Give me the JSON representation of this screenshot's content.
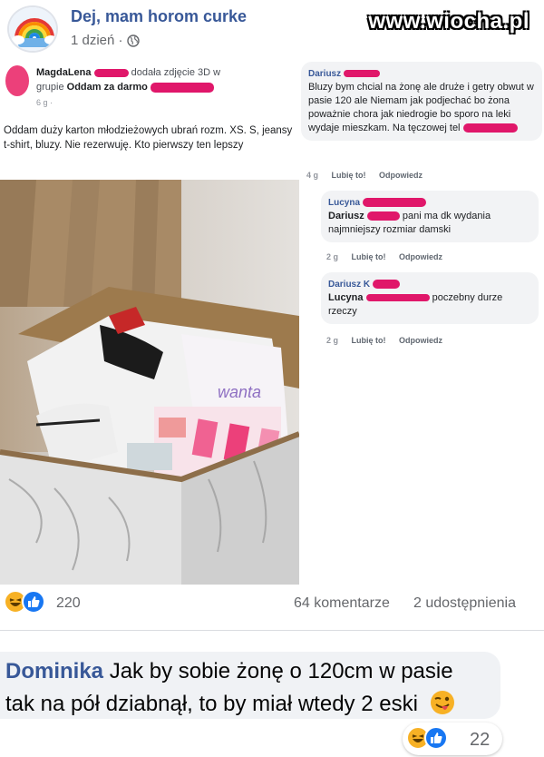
{
  "header": {
    "page_name": "Dej, mam horom curke",
    "time": "1 dzień ·",
    "watermark": "www.wiocha.pl"
  },
  "inner_post": {
    "author": "MagdaLena",
    "action": "dodała zdjęcie 3D w",
    "group_prefix": "grupie",
    "group_name": "Oddam za darmo",
    "time": "6 g ·",
    "body": "Oddam duży karton młodzieżowych ubrań rozm. XS. S, jeansy t-shirt, bluzy. Nie rezerwuję. Kto pierwszy ten lepszy",
    "box_label": "wanta"
  },
  "screenshot_comments": [
    {
      "author": "Dariusz",
      "text": "Bluzy bym chcial na żonę ale druże i getry obwut w pasie 120 ale Niemam jak podjechać bo żona poważnie chora jak niedrogie bo sporo na leki wydaje mieszkam. Na tęczowej tel",
      "time": "4 g",
      "like": "Lubię to!",
      "reply": "Odpowiedz"
    },
    {
      "author": "Lucyna",
      "mention": "Dariusz",
      "text": "pani ma dk wydania najmniejszy rozmiar damski",
      "time": "2 g",
      "like": "Lubię to!",
      "reply": "Odpowiedz"
    },
    {
      "author": "Dariusz K",
      "mention": "Lucyna",
      "text": "poczebny durze rzeczy",
      "time": "2 g",
      "like": "Lubię to!",
      "reply": "Odpowiedz"
    }
  ],
  "reactions": {
    "count": "220",
    "comments": "64 komentarze",
    "shares": "2 udostępnienia"
  },
  "main_comment": {
    "author": "Dominika",
    "line1": "Jak by sobie żonę o 120cm w pasie",
    "line2": "tak na pół dziabnął, to by miał wtedy 2 eski",
    "reaction_count": "22"
  },
  "colors": {
    "fb_blue": "#385898",
    "like_blue": "#1877f2",
    "haha_yellow": "#f7b125",
    "redaction_pink": "#e0176a"
  },
  "icons": [
    "rainbow-avatar-icon",
    "globe-icon",
    "haha-reaction-icon",
    "like-reaction-icon",
    "tongue-wink-emoji-icon"
  ]
}
